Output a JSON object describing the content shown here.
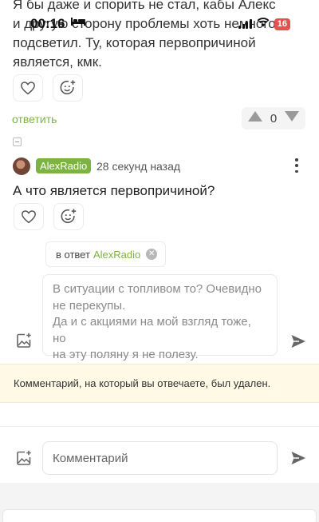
{
  "status_bar": {
    "time": "00:16",
    "battery": "16",
    "icons": [
      "bed-icon",
      "signal-icon",
      "wifi-icon",
      "battery-icon"
    ]
  },
  "previous_comment": {
    "text_lines": [
      "Я бы даже и спорить не стал, кабы Алекс",
      "и другую сторону проблемы хоть немного",
      "подсветил. Ту, которая первопричиной",
      "является, кмк."
    ],
    "reply_label": "ответить",
    "vote_count": "0"
  },
  "comment": {
    "author": "AlexRadio",
    "time_ago": "28 секунд назад",
    "text": "А что является первопричиной?"
  },
  "reply_form": {
    "in_reply_prefix": "в ответ",
    "in_reply_name": "AlexRadio",
    "close_symbol": "✕",
    "text_lines": [
      "В ситуации с топливом то? Очевидно",
      "не перекупы.",
      "Да и с акциями на мой взгляд тоже, но",
      "на эту поляну я не полезу."
    ]
  },
  "notice": {
    "text": "Комментарий, на который вы отвечаете, был удален."
  },
  "comment_form": {
    "placeholder": "Комментарий"
  },
  "colors": {
    "accent": "#7cb342",
    "notice_bg": "#fff9e6",
    "battery": "#e2524f"
  }
}
